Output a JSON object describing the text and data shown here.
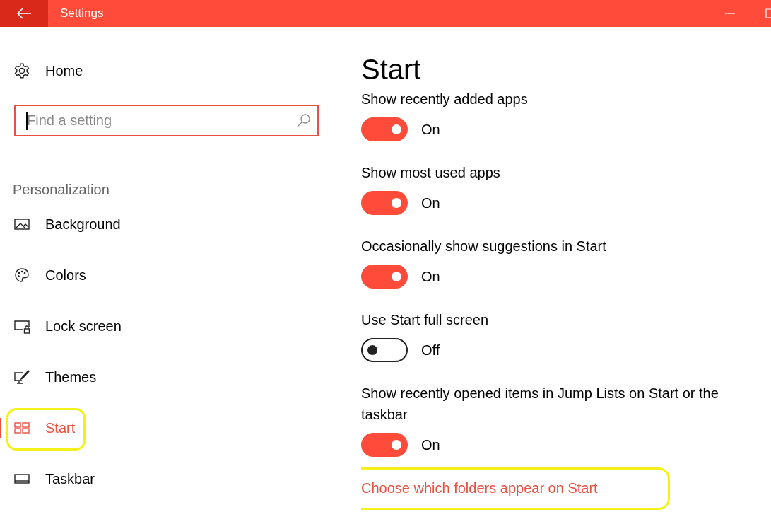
{
  "window": {
    "title": "Settings"
  },
  "sidebar": {
    "home": "Home",
    "search": {
      "placeholder": "Find a setting",
      "focused": true
    },
    "section": "Personalization",
    "items": [
      {
        "label": "Background",
        "kind": "picture",
        "selected": false,
        "highlighted": false
      },
      {
        "label": "Colors",
        "kind": "palette",
        "selected": false,
        "highlighted": false
      },
      {
        "label": "Lock screen",
        "kind": "lock-screen",
        "selected": false,
        "highlighted": false
      },
      {
        "label": "Themes",
        "kind": "themes",
        "selected": false,
        "highlighted": false
      },
      {
        "label": "Start",
        "kind": "start",
        "selected": true,
        "highlighted": true
      },
      {
        "label": "Taskbar",
        "kind": "taskbar",
        "selected": false,
        "highlighted": false
      }
    ]
  },
  "content": {
    "heading": "Start",
    "settings": [
      {
        "label": "Show recently added apps",
        "on": true,
        "state": "On"
      },
      {
        "label": "Show most used apps",
        "on": true,
        "state": "On"
      },
      {
        "label": "Occasionally show suggestions in Start",
        "on": true,
        "state": "On"
      },
      {
        "label": "Use Start full screen",
        "on": false,
        "state": "Off"
      },
      {
        "label": "Show recently opened items in Jump Lists on Start or the taskbar",
        "on": true,
        "state": "On"
      }
    ],
    "link": {
      "text": "Choose which folders appear on Start",
      "highlighted": true
    }
  }
}
